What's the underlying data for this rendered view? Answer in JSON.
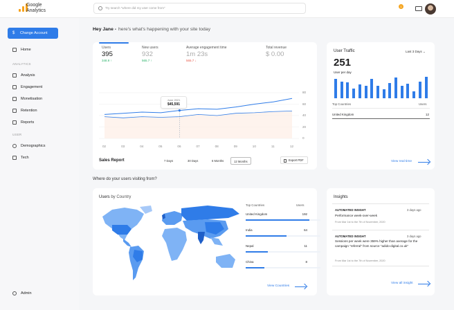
{
  "brand": {
    "line1": "Google",
    "line2": "Analytics",
    "colors": {
      "accent": "#2f7ce8",
      "logo": "#f7a21b"
    }
  },
  "search": {
    "placeholder": "Try search \"where did my user come from\""
  },
  "header": {
    "notif_count": "1",
    "icons": [
      "bell-icon",
      "mail-icon",
      "avatar"
    ]
  },
  "sidebar": {
    "change_account": "Change Account",
    "home": "Home",
    "analytics_label": "ANALYTICS",
    "analytics_items": [
      "Analysis",
      "Engagement",
      "Monetisation",
      "Retention",
      "Reports"
    ],
    "users_label": "USER",
    "users_items": [
      "Demographics",
      "Tech"
    ],
    "admin": "Admin"
  },
  "greeting": {
    "name": "Hey Jane -",
    "sub": "here's what's happening with your site today"
  },
  "kpis": [
    {
      "label": "Users",
      "value": "395",
      "change": "348.9",
      "dir": "up"
    },
    {
      "label": "New users",
      "value": "932",
      "change": "565.7",
      "dir": "up"
    },
    {
      "label": "Average engagement time",
      "value": "1m 23s",
      "change": "565.7",
      "dir": "down"
    },
    {
      "label": "Total revenue",
      "value": "$ 0.00",
      "change": "",
      "dir": ""
    }
  ],
  "chart_data": {
    "type": "line",
    "x": [
      "02",
      "03",
      "04",
      "05",
      "06",
      "07",
      "08",
      "09",
      "10",
      "11",
      "12"
    ],
    "y_ticks": [
      "0",
      "20",
      "40",
      "60",
      "80"
    ],
    "ylim": [
      0,
      80
    ],
    "series": [
      {
        "values": [
          42,
          44,
          46,
          45,
          49,
          52,
          51,
          55,
          60,
          64,
          70
        ]
      },
      {
        "values": [
          38,
          36,
          38,
          37,
          38,
          42,
          40,
          44,
          45,
          47,
          48
        ]
      }
    ],
    "tooltip": {
      "month": "June 2021",
      "value": "$45,591",
      "x_index": 4
    }
  },
  "sales": {
    "title": "Sales Report",
    "ranges": [
      "7 Days",
      "30 Days",
      "6 Months",
      "12 Months"
    ],
    "selected": "12 Months",
    "export": "Export PDF"
  },
  "traffic": {
    "title": "User Traffic",
    "range": "Last 3 Days",
    "value": "251",
    "sub": "User per day",
    "bars": [
      28,
      24,
      23,
      14,
      20,
      18,
      28,
      18,
      13,
      22,
      30,
      18,
      21,
      10,
      24,
      31
    ],
    "col_left": "Top Countries",
    "col_right": "Users",
    "row_country": "United Kingdom",
    "row_value": "12",
    "link": "View real time"
  },
  "where": "Where do your users visiting from?",
  "users_country": {
    "title_a": "Users",
    "title_b": "by Country",
    "col_left": "Top Countries",
    "col_right": "Users",
    "rows": [
      {
        "name": "United Kingdom",
        "value": "192",
        "share": 0.85
      },
      {
        "name": "India",
        "value": "64",
        "share": 0.55
      },
      {
        "name": "Nepal",
        "value": "11",
        "share": 0.3
      },
      {
        "name": "China",
        "value": "8",
        "share": 0.25
      }
    ],
    "link": "View Countries"
  },
  "insights": {
    "title": "Insights",
    "items": [
      {
        "tag": "AUTOMATED INSIGHT",
        "time": "3 days ago",
        "text": "Performance week-over-week",
        "from": "From Mar 1st to the 7th of November, 2020"
      },
      {
        "tag": "AUTOMATED INSIGHT",
        "time": "3 days ago",
        "text": "Sessions per week were 359% higher than average for the campaign \"referral\" from source \"adido-digital.co.uk\"",
        "from": "From Mar 1st to the 7th of November, 2020"
      }
    ],
    "link": "View all insight"
  }
}
